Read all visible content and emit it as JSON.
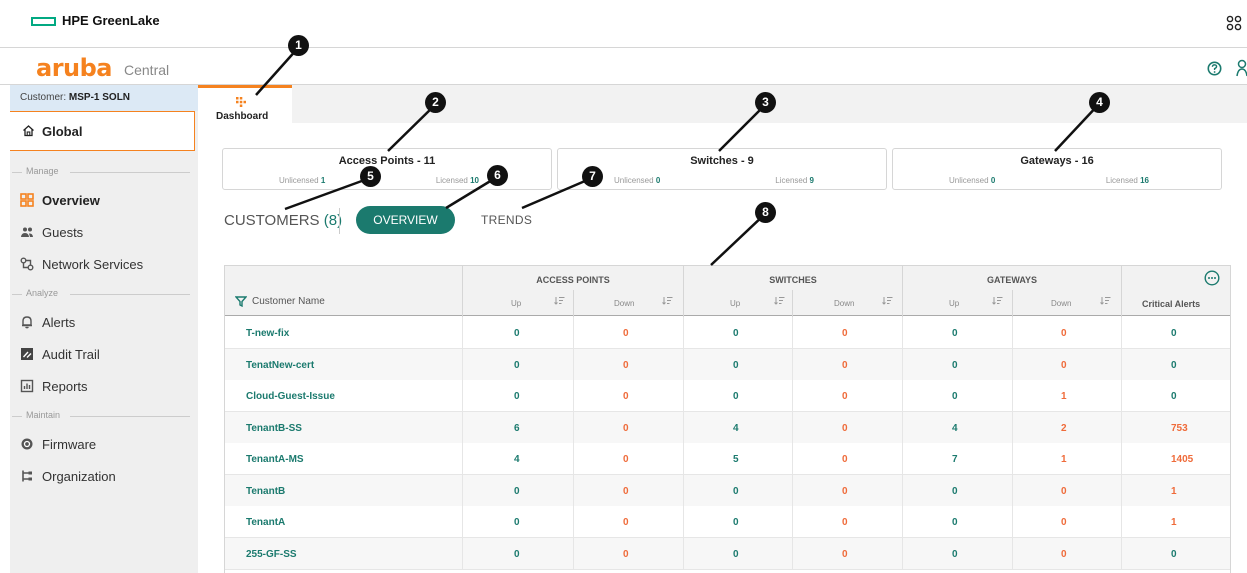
{
  "hpe": {
    "brand": "HPE GreenLake"
  },
  "aruba": {
    "logo": "aruba",
    "product": "Central"
  },
  "sidebar": {
    "customer_prefix": "Customer: ",
    "customer_name": "MSP-1 SOLN",
    "global": "Global",
    "sections": {
      "manage": "Manage",
      "analyze": "Analyze",
      "maintain": "Maintain"
    },
    "items": [
      {
        "label": "Overview",
        "icon": "overview-grid-icon"
      },
      {
        "label": "Guests",
        "icon": "guests-icon"
      },
      {
        "label": "Network Services",
        "icon": "network-services-icon"
      },
      {
        "label": "Alerts",
        "icon": "bell-icon"
      },
      {
        "label": "Audit Trail",
        "icon": "audit-trail-icon"
      },
      {
        "label": "Reports",
        "icon": "reports-icon"
      },
      {
        "label": "Firmware",
        "icon": "firmware-icon"
      },
      {
        "label": "Organization",
        "icon": "organization-icon"
      }
    ]
  },
  "tabs": {
    "dashboard": "Dashboard"
  },
  "cards": {
    "access_points": {
      "title": "Access Points - 11",
      "unlicensed_label": "Unlicensed",
      "unlicensed": "1",
      "licensed_label": "Licensed",
      "licensed": "10"
    },
    "switches": {
      "title": "Switches - 9",
      "unlicensed_label": "Unlicensed",
      "unlicensed": "0",
      "licensed_label": "Licensed",
      "licensed": "9"
    },
    "gateways": {
      "title": "Gateways - 16",
      "unlicensed_label": "Unlicensed",
      "unlicensed": "0",
      "licensed_label": "Licensed",
      "licensed": "16"
    }
  },
  "customers": {
    "title": "CUSTOMERS",
    "count": "(8)",
    "overview_btn": "OVERVIEW",
    "trends_btn": "TRENDS"
  },
  "table": {
    "name_header": "Customer Name",
    "groups": {
      "ap": "ACCESS POINTS",
      "sw": "SWITCHES",
      "gw": "GATEWAYS"
    },
    "up": "Up",
    "down": "Down",
    "critical": "Critical Alerts",
    "rows": [
      {
        "name": "T-new-fix",
        "ap_up": "0",
        "ap_down": "0",
        "sw_up": "0",
        "sw_down": "0",
        "gw_up": "0",
        "gw_down": "0",
        "crit": "0"
      },
      {
        "name": "TenatNew-cert",
        "ap_up": "0",
        "ap_down": "0",
        "sw_up": "0",
        "sw_down": "0",
        "gw_up": "0",
        "gw_down": "0",
        "crit": "0"
      },
      {
        "name": "Cloud-Guest-Issue",
        "ap_up": "0",
        "ap_down": "0",
        "sw_up": "0",
        "sw_down": "0",
        "gw_up": "0",
        "gw_down": "1",
        "crit": "0"
      },
      {
        "name": "TenantB-SS",
        "ap_up": "6",
        "ap_down": "0",
        "sw_up": "4",
        "sw_down": "0",
        "gw_up": "4",
        "gw_down": "2",
        "crit": "753"
      },
      {
        "name": "TenantA-MS",
        "ap_up": "4",
        "ap_down": "0",
        "sw_up": "5",
        "sw_down": "0",
        "gw_up": "7",
        "gw_down": "1",
        "crit": "1405"
      },
      {
        "name": "TenantB",
        "ap_up": "0",
        "ap_down": "0",
        "sw_up": "0",
        "sw_down": "0",
        "gw_up": "0",
        "gw_down": "0",
        "crit": "1"
      },
      {
        "name": "TenantA",
        "ap_up": "0",
        "ap_down": "0",
        "sw_up": "0",
        "sw_down": "0",
        "gw_up": "0",
        "gw_down": "0",
        "crit": "1"
      },
      {
        "name": "255-GF-SS",
        "ap_up": "0",
        "ap_down": "0",
        "sw_up": "0",
        "sw_down": "0",
        "gw_up": "0",
        "gw_down": "0",
        "crit": "0"
      }
    ]
  },
  "callouts": [
    "1",
    "2",
    "3",
    "4",
    "5",
    "6",
    "7",
    "8"
  ],
  "colors": {
    "accent": "#f5821f",
    "teal": "#1b7a6e",
    "alert": "#ef6b3a",
    "hpe_green": "#01a982"
  }
}
